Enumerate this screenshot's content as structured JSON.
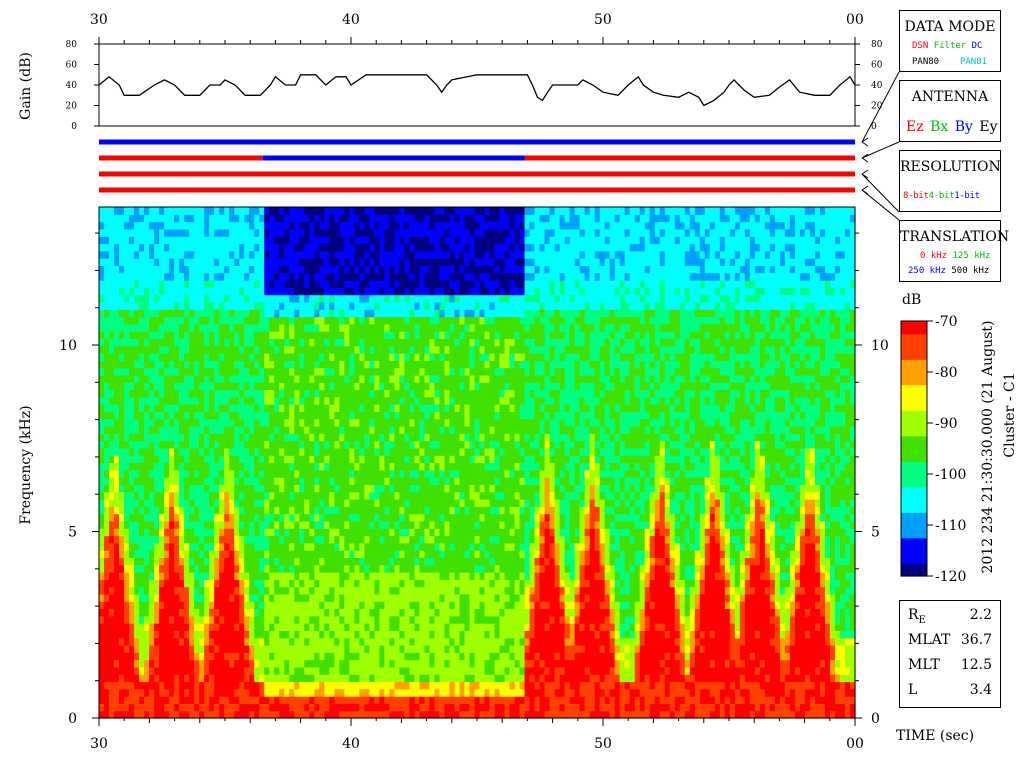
{
  "chart_data": {
    "type": "heatmap",
    "title": "",
    "xlabel": "TIME (sec)",
    "ylabel": "Frequency (kHz)",
    "xlim": [
      30,
      60
    ],
    "ylim": [
      0,
      13.7
    ],
    "x_tick_labels": [
      "30",
      "40",
      "50",
      "00"
    ],
    "x_tick_values": [
      30,
      40,
      50,
      60
    ],
    "y_tick_values": [
      0,
      5,
      10
    ],
    "y_tick_labels": [
      "0",
      "5",
      "10"
    ],
    "colorbar": {
      "label": "dB",
      "range": [
        -120,
        -70
      ],
      "ticks": [
        -70,
        -80,
        -90,
        -100,
        -110,
        -120
      ],
      "tick_labels": [
        "-70",
        "-80",
        "-90",
        "-100",
        "-110",
        "-120"
      ]
    },
    "vertical_caption": "2012 234 21:30:30.000 (21 August)",
    "spacecraft_caption": "Cluster - C1",
    "gain_panel": {
      "ylabel": "Gain (dB)",
      "ylim": [
        0,
        80
      ],
      "tick_values": [
        0,
        20,
        40,
        60,
        80
      ],
      "tick_labels": [
        "0",
        "20",
        "40",
        "60",
        "80"
      ],
      "trace": [
        [
          30,
          40
        ],
        [
          30.4,
          48
        ],
        [
          30.8,
          40
        ],
        [
          31,
          30
        ],
        [
          31.6,
          30
        ],
        [
          32.2,
          40
        ],
        [
          32.6,
          45
        ],
        [
          33,
          40
        ],
        [
          33.4,
          30
        ],
        [
          34,
          30
        ],
        [
          34.4,
          40
        ],
        [
          34.8,
          40
        ],
        [
          35,
          45
        ],
        [
          35.4,
          40
        ],
        [
          35.8,
          30
        ],
        [
          36.4,
          30
        ],
        [
          36.8,
          40
        ],
        [
          37,
          48
        ],
        [
          37.4,
          40
        ],
        [
          37.8,
          40
        ],
        [
          38,
          50
        ],
        [
          38.6,
          50
        ],
        [
          39,
          40
        ],
        [
          39.4,
          48
        ],
        [
          39.8,
          48
        ],
        [
          40,
          40
        ],
        [
          40.6,
          50
        ],
        [
          43,
          50
        ],
        [
          43.4,
          40
        ],
        [
          43.6,
          33
        ],
        [
          43.8,
          40
        ],
        [
          44,
          45
        ],
        [
          45,
          50
        ],
        [
          47,
          50
        ],
        [
          47.2,
          40
        ],
        [
          47.4,
          28
        ],
        [
          47.6,
          25
        ],
        [
          47.8,
          33
        ],
        [
          48,
          40
        ],
        [
          49,
          40
        ],
        [
          49.2,
          45
        ],
        [
          49.6,
          40
        ],
        [
          50,
          33
        ],
        [
          50.6,
          30
        ],
        [
          51,
          40
        ],
        [
          51.4,
          48
        ],
        [
          51.6,
          40
        ],
        [
          52,
          33
        ],
        [
          52.4,
          30
        ],
        [
          53,
          28
        ],
        [
          53.4,
          33
        ],
        [
          53.8,
          28
        ],
        [
          54,
          20
        ],
        [
          54.4,
          25
        ],
        [
          54.8,
          33
        ],
        [
          55,
          40
        ],
        [
          55.2,
          45
        ],
        [
          55.6,
          35
        ],
        [
          56,
          28
        ],
        [
          56.6,
          30
        ],
        [
          57,
          38
        ],
        [
          57.4,
          45
        ],
        [
          57.8,
          33
        ],
        [
          58.4,
          30
        ],
        [
          59,
          30
        ],
        [
          59.4,
          40
        ],
        [
          59.8,
          48
        ],
        [
          60,
          40
        ]
      ]
    },
    "antenna_lines": [
      {
        "segments": [
          {
            "from": 30,
            "to": 60,
            "color": "#0000ff"
          }
        ]
      },
      {
        "segments": [
          {
            "from": 30,
            "to": 36.5,
            "color": "#ff0000"
          },
          {
            "from": 36.5,
            "to": 46.9,
            "color": "#0000ff"
          },
          {
            "from": 46.9,
            "to": 60,
            "color": "#ff0000"
          }
        ]
      },
      {
        "segments": [
          {
            "from": 30,
            "to": 60,
            "color": "#ff0000"
          }
        ]
      },
      {
        "segments": [
          {
            "from": 30,
            "to": 60,
            "color": "#ff0000"
          }
        ]
      }
    ],
    "regions": [
      {
        "x": [
          30,
          36.5
        ],
        "pattern": "bursting",
        "peaks_x": [
          30.6,
          32.9,
          35.1
        ],
        "peak_top_khz": 6.2
      },
      {
        "x": [
          36.5,
          46.9
        ],
        "pattern": "quiet",
        "dark_band_khz": [
          11.3,
          13.7
        ]
      },
      {
        "x": [
          46.9,
          60
        ],
        "pattern": "bursting",
        "peaks_x": [
          47.8,
          49.6,
          52.3,
          54.4,
          56.2,
          58.2
        ],
        "peak_top_khz": 6.5
      }
    ]
  },
  "legend": {
    "data_mode": {
      "title": "DATA MODE",
      "items": [
        {
          "text": "DSN",
          "color": "#ff0000"
        },
        {
          "text": "Filter",
          "color": "#00c000"
        },
        {
          "text": "DC",
          "color": "#0000ff"
        },
        {
          "text": "PAN80",
          "color": "#000000"
        },
        {
          "text": "PAN81",
          "color": "#00c0c0"
        }
      ]
    },
    "antenna": {
      "title": "ANTENNA",
      "items": [
        {
          "text": "Ez",
          "color": "#ff0000"
        },
        {
          "text": "Bx",
          "color": "#00c000"
        },
        {
          "text": "By",
          "color": "#0000ff"
        },
        {
          "text": "Ey",
          "color": "#000000"
        }
      ]
    },
    "resolution": {
      "title": "RESOLUTION",
      "items": [
        {
          "text": "8-bit",
          "color": "#ff0000"
        },
        {
          "text": "4-bit",
          "color": "#00c000"
        },
        {
          "text": "1-bit",
          "color": "#0000ff"
        }
      ]
    },
    "translation": {
      "title": "TRANSLATION",
      "items": [
        {
          "text": "0 kHz",
          "color": "#ff0000"
        },
        {
          "text": "125 kHz",
          "color": "#00c000"
        },
        {
          "text": "250 kHz",
          "color": "#0000ff"
        },
        {
          "text": "500 kHz",
          "color": "#000000"
        }
      ]
    }
  },
  "params": [
    {
      "key": "R",
      "sub": "E",
      "value": "2.2"
    },
    {
      "key": "MLAT",
      "sub": "",
      "value": "36.7"
    },
    {
      "key": "MLT",
      "sub": "",
      "value": "12.5"
    },
    {
      "key": "L",
      "sub": "",
      "value": "3.4"
    }
  ],
  "colors": {
    "colormap": [
      "#000080",
      "#0000ff",
      "#00a0ff",
      "#00ffff",
      "#00ff80",
      "#40e000",
      "#a0ff00",
      "#ffff00",
      "#ffa000",
      "#ff4000",
      "#ff0000"
    ]
  }
}
